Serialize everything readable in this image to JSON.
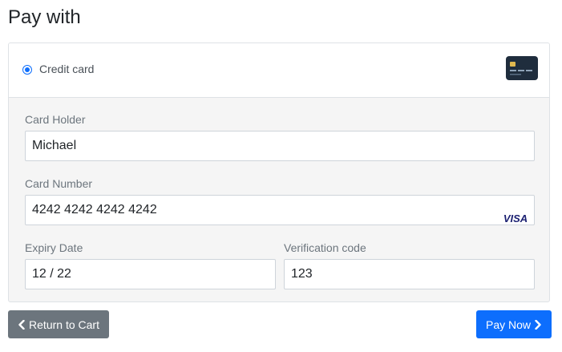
{
  "page": {
    "title": "Pay with"
  },
  "payment_method": {
    "label": "Credit card",
    "selected": true,
    "icon": "credit-card-icon"
  },
  "form": {
    "card_holder": {
      "label": "Card Holder",
      "value": "Michael"
    },
    "card_number": {
      "label": "Card Number",
      "value": "4242 4242 4242 4242",
      "brand": "VISA"
    },
    "expiry": {
      "label": "Expiry Date",
      "value": "12 / 22"
    },
    "cvc": {
      "label": "Verification code",
      "value": "123"
    }
  },
  "actions": {
    "return_label": "Return to Cart",
    "pay_label": "Pay Now"
  },
  "colors": {
    "primary": "#0d6efd",
    "secondary": "#6c757d",
    "visa_blue": "#1a1f71"
  }
}
